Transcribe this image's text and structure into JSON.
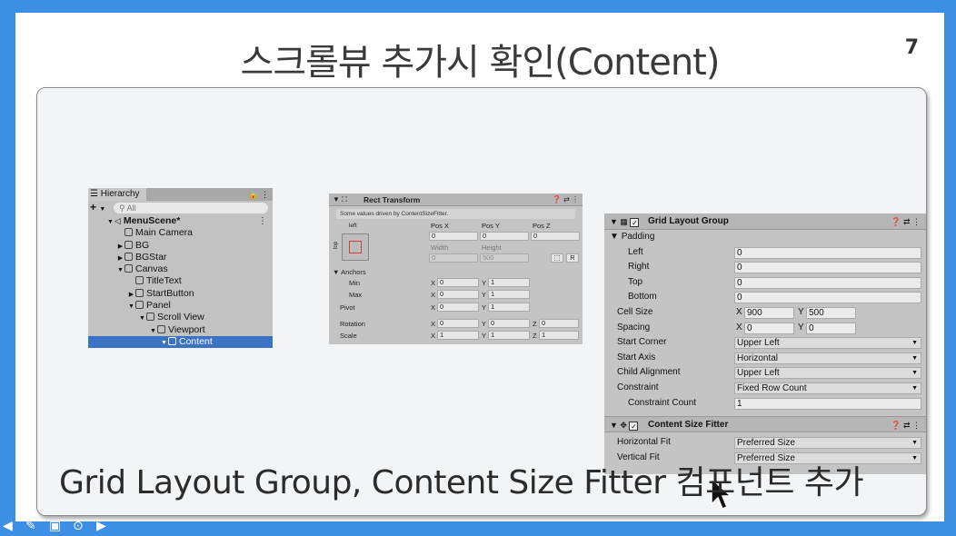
{
  "slide": {
    "title": "스크롤뷰 추가시 확인(Content)",
    "page_number": "7",
    "caption": "Grid Layout Group, Content Size Fitter 컴포넌트 추가"
  },
  "hierarchy": {
    "tab": "Hierarchy",
    "search_placeholder": "All",
    "items": [
      {
        "label": "MenuScene*"
      },
      {
        "label": "Main Camera"
      },
      {
        "label": "BG"
      },
      {
        "label": "BGStar"
      },
      {
        "label": "Canvas"
      },
      {
        "label": "TitleText"
      },
      {
        "label": "StartButton"
      },
      {
        "label": "Panel"
      },
      {
        "label": "Scroll View"
      },
      {
        "label": "Viewport"
      },
      {
        "label": "Content"
      }
    ]
  },
  "rect_transform": {
    "title": "Rect Transform",
    "note": "Some values driven by ContentSizeFitter.",
    "anchor_left": "left",
    "anchor_top": "top",
    "pos_x_label": "Pos X",
    "pos_y_label": "Pos Y",
    "pos_z_label": "Pos Z",
    "pos_x": "0",
    "pos_y": "0",
    "pos_z": "0",
    "width_label": "Width",
    "height_label": "Height",
    "width": "0",
    "height": "500",
    "r_button": "R",
    "anchors_label": "Anchors",
    "min_label": "Min",
    "max_label": "Max",
    "pivot_label": "Pivot",
    "rotation_label": "Rotation",
    "scale_label": "Scale",
    "min_x": "0",
    "min_y": "1",
    "max_x": "0",
    "max_y": "1",
    "pivot_x": "0",
    "pivot_y": "1",
    "rot_x": "0",
    "rot_y": "0",
    "rot_z": "0",
    "scale_x": "1",
    "scale_y": "1",
    "scale_z": "1",
    "x": "X",
    "y": "Y",
    "z": "Z"
  },
  "grid_layout": {
    "title": "Grid Layout Group",
    "padding_label": "Padding",
    "left_label": "Left",
    "left": "0",
    "right_label": "Right",
    "right": "0",
    "top_label": "Top",
    "top": "0",
    "bottom_label": "Bottom",
    "bottom": "0",
    "cell_size_label": "Cell Size",
    "cell_x": "900",
    "cell_y": "500",
    "spacing_label": "Spacing",
    "spacing_x": "0",
    "spacing_y": "0",
    "start_corner_label": "Start Corner",
    "start_corner": "Upper Left",
    "start_axis_label": "Start Axis",
    "start_axis": "Horizontal",
    "child_alignment_label": "Child Alignment",
    "child_alignment": "Upper Left",
    "constraint_label": "Constraint",
    "constraint": "Fixed Row Count",
    "constraint_count_label": "Constraint Count",
    "constraint_count": "1",
    "x": "X",
    "y": "Y"
  },
  "content_size_fitter": {
    "title": "Content Size Fitter",
    "horizontal_fit_label": "Horizontal Fit",
    "horizontal_fit": "Preferred Size",
    "vertical_fit_label": "Vertical Fit",
    "vertical_fit": "Preferred Size"
  },
  "icons": {
    "check": "✓",
    "menu": "⋮"
  }
}
